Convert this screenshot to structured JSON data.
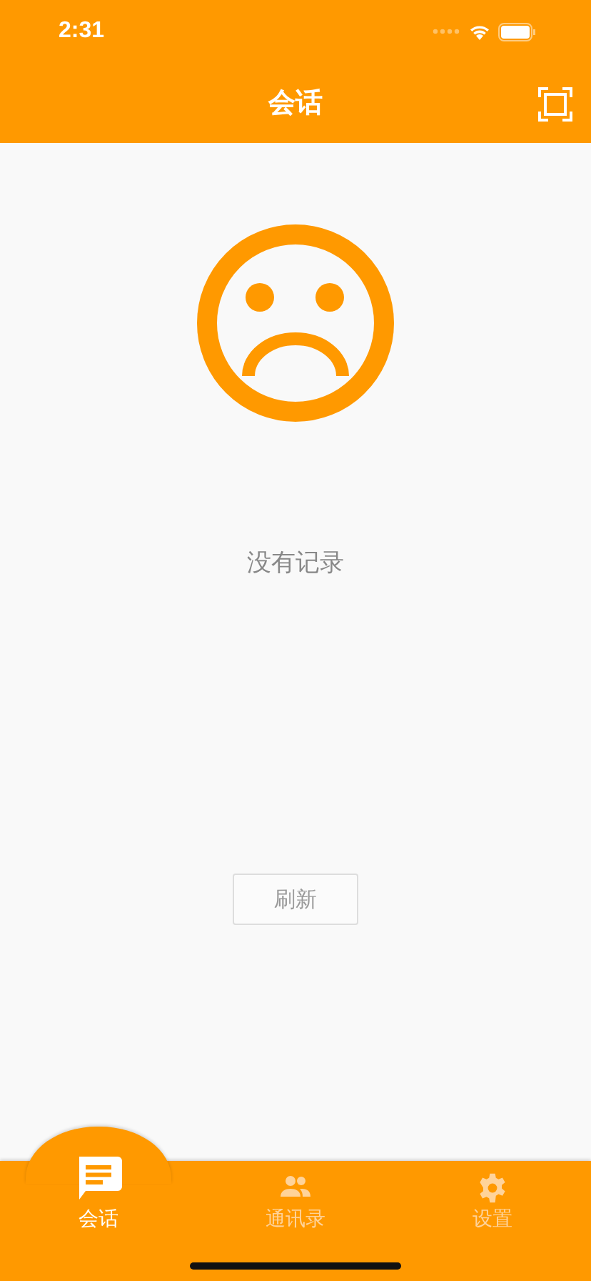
{
  "status_bar": {
    "time": "2:31"
  },
  "nav": {
    "title": "会话"
  },
  "empty": {
    "message": "没有记录",
    "button": "刷新"
  },
  "tabs": [
    {
      "label": "会话",
      "kind": "chat",
      "selected": true
    },
    {
      "label": "通讯录",
      "kind": "contacts",
      "selected": false
    },
    {
      "label": "设置",
      "kind": "settings",
      "selected": false
    }
  ]
}
